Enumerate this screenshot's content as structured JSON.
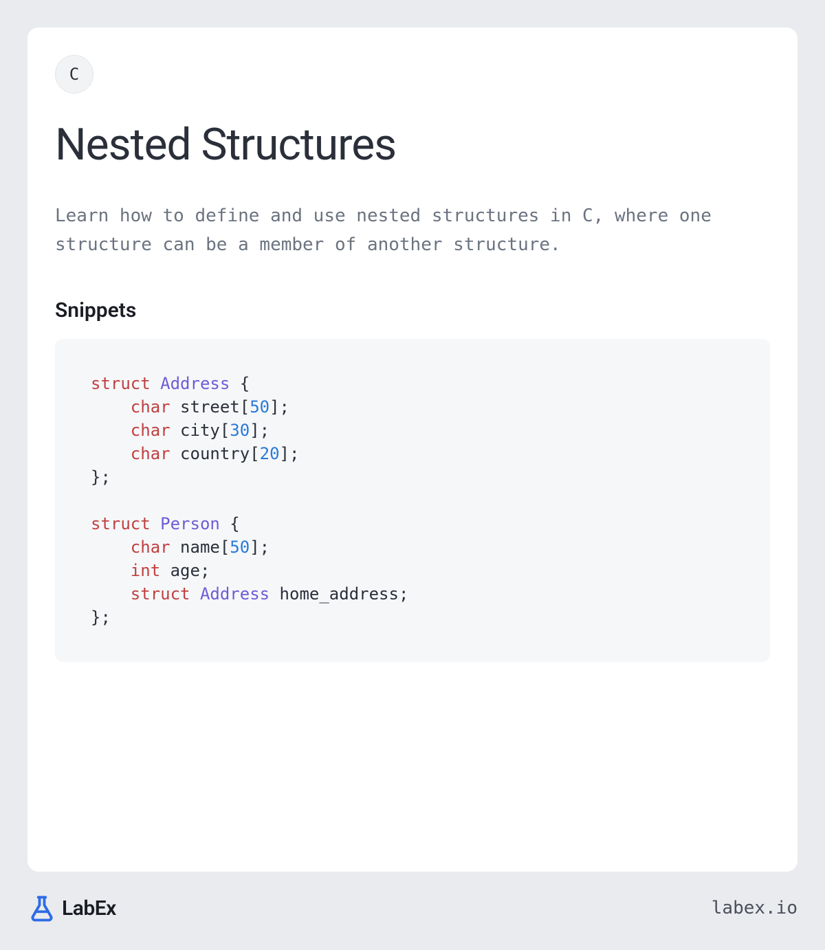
{
  "lang_badge": "C",
  "title": "Nested Structures",
  "description": "Learn how to define and use nested structures in C, where one structure can be a member of another structure.",
  "snippets_heading": "Snippets",
  "code": {
    "tokens": [
      {
        "t": "struct",
        "c": "kw-struct"
      },
      {
        "t": " "
      },
      {
        "t": "Address",
        "c": "type-name"
      },
      {
        "t": " {\n"
      },
      {
        "t": "    "
      },
      {
        "t": "char",
        "c": "kw-type"
      },
      {
        "t": " street["
      },
      {
        "t": "50",
        "c": "num"
      },
      {
        "t": "];\n"
      },
      {
        "t": "    "
      },
      {
        "t": "char",
        "c": "kw-type"
      },
      {
        "t": " city["
      },
      {
        "t": "30",
        "c": "num"
      },
      {
        "t": "];\n"
      },
      {
        "t": "    "
      },
      {
        "t": "char",
        "c": "kw-type"
      },
      {
        "t": " country["
      },
      {
        "t": "20",
        "c": "num"
      },
      {
        "t": "];\n"
      },
      {
        "t": "};\n"
      },
      {
        "t": "\n"
      },
      {
        "t": "struct",
        "c": "kw-struct"
      },
      {
        "t": " "
      },
      {
        "t": "Person",
        "c": "type-name"
      },
      {
        "t": " {\n"
      },
      {
        "t": "    "
      },
      {
        "t": "char",
        "c": "kw-type"
      },
      {
        "t": " name["
      },
      {
        "t": "50",
        "c": "num"
      },
      {
        "t": "];\n"
      },
      {
        "t": "    "
      },
      {
        "t": "int",
        "c": "kw-type"
      },
      {
        "t": " age;\n"
      },
      {
        "t": "    "
      },
      {
        "t": "struct",
        "c": "kw-struct"
      },
      {
        "t": " "
      },
      {
        "t": "Address",
        "c": "type-name"
      },
      {
        "t": " home_address;\n"
      },
      {
        "t": "};"
      }
    ]
  },
  "footer": {
    "logo_text": "LabEx",
    "site": "labex.io"
  }
}
